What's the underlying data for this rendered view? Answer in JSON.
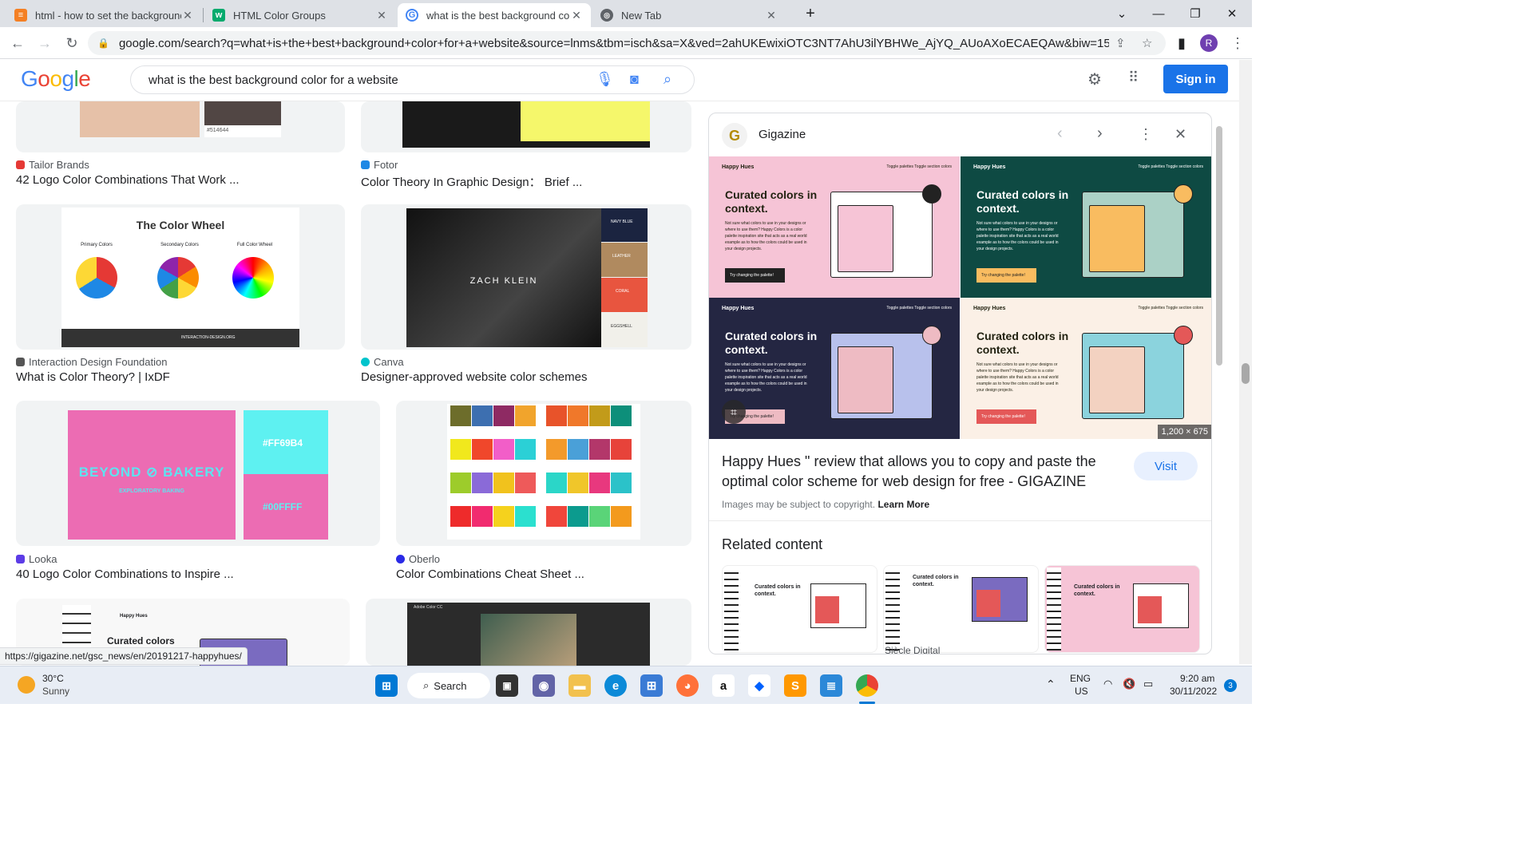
{
  "browser": {
    "tabs": [
      {
        "title": "html - how to set the background",
        "active": false
      },
      {
        "title": "HTML Color Groups",
        "active": false
      },
      {
        "title": "what is the best background colo",
        "active": true
      },
      {
        "title": "New Tab",
        "active": false
      }
    ],
    "url": "google.com/search?q=what+is+the+best+background+color+for+a+website&source=lnms&tbm=isch&sa=X&ved=2ahUKEwixiOTC3NT7AhU3ilYBHWe_AjYQ_AUoAXoECAEQAw&biw=1536&bih...",
    "profile_initial": "R"
  },
  "google": {
    "logo": "Google",
    "query": "what is the best background color for a website",
    "sign_in": "Sign in"
  },
  "results": [
    {
      "source": "Tailor Brands",
      "title": "42 Logo Color Combinations That Work ...",
      "source_color": "#e53935"
    },
    {
      "source": "Fotor",
      "title": "Color Theory In Graphic Design： Brief ...",
      "source_color": "#1e88e5"
    },
    {
      "source": "Interaction Design Foundation",
      "title": "What is Color Theory? | IxDF",
      "source_color": "#555555"
    },
    {
      "source": "Canva",
      "title": "Designer-approved website color schemes",
      "source_color": "#00c4cc"
    },
    {
      "source": "Looka",
      "title": "40 Logo Color Combinations to Inspire ...",
      "source_color": "#5c3ce6"
    },
    {
      "source": "Oberlo",
      "title": "Color Combinations Cheat Sheet ...",
      "source_color": "#2a2ae6"
    }
  ],
  "thumbs": {
    "hex_label": "#514644",
    "color_wheel_title": "The Color Wheel",
    "color_wheel_labels": [
      "Primary Colors",
      "Secondary Colors",
      "Full Color Wheel"
    ],
    "color_wheel_footer": "INTERACTION-DESIGN.ORG",
    "zach_klein": "ZACH KLEIN",
    "swatches": [
      "NAVY BLUE",
      "LEATHER",
      "CORAL",
      "EGGSHELL"
    ],
    "bakery": "BEYOND ⊘ BAKERY",
    "bakery_sub": "EXPLORATORY BAKING",
    "hex_pink": "#FF69B4",
    "hex_cyan": "#00FFFF",
    "happy_hues": "Happy Hues",
    "curated": "Curated colors",
    "adobe": "Adobe Color CC"
  },
  "panel": {
    "site": "Gigazine",
    "image_size": "1,200 × 675",
    "title": "Happy Hues \" review that allows you to copy and paste the optimal color scheme for web design for free - GIGAZINE",
    "visit": "Visit",
    "copyright": "Images may be subject to copyright.",
    "learn_more": "Learn More",
    "related": "Related content",
    "related_caption": "Siècle Digital",
    "quad_head": "Happy Hues",
    "quad_toggle": "Toggle palettes  Toggle section colors",
    "quad_title": "Curated colors in context.",
    "quad_body": "Not sure what colors to use in your designs or where to use them? Happy Colors is a color palette inspiration site that acts as a real world example as to how the colors could be used in your design projects.",
    "quad_btn": "Try changing the palette!"
  },
  "status_url": "https://gigazine.net/gsc_news/en/20191217-happyhues/",
  "taskbar": {
    "temp": "30°C",
    "weather": "Sunny",
    "search": "Search",
    "lang1": "ENG",
    "lang2": "US",
    "time": "9:20 am",
    "date": "30/11/2022",
    "notif": "3"
  }
}
